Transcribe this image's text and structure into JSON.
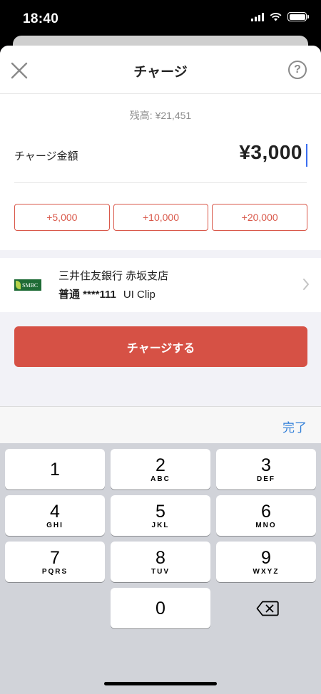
{
  "status_bar": {
    "time": "18:40"
  },
  "nav": {
    "title": "チャージ",
    "close_icon": "close-icon",
    "help_label": "?"
  },
  "amount": {
    "balance": "残高: ¥21,451",
    "label": "チャージ金額",
    "value": "¥3,000",
    "quick_buttons": [
      "+5,000",
      "+10,000",
      "+20,000"
    ]
  },
  "bank": {
    "logo_text": "SMBC",
    "name": "三井住友銀行 赤坂支店",
    "account": "普通 ****111",
    "clip": "UI Clip"
  },
  "charge_button": "チャージする",
  "keyboard": {
    "done": "完了",
    "keys": [
      {
        "num": "1",
        "letters": ""
      },
      {
        "num": "2",
        "letters": "ABC"
      },
      {
        "num": "3",
        "letters": "DEF"
      },
      {
        "num": "4",
        "letters": "GHI"
      },
      {
        "num": "5",
        "letters": "JKL"
      },
      {
        "num": "6",
        "letters": "MNO"
      },
      {
        "num": "7",
        "letters": "PQRS"
      },
      {
        "num": "8",
        "letters": "TUV"
      },
      {
        "num": "9",
        "letters": "WXYZ"
      },
      {
        "num": "0",
        "letters": ""
      }
    ]
  },
  "colors": {
    "accent": "#d65145",
    "link": "#2f7ed8",
    "keyboard_bg": "#d1d3d9"
  }
}
